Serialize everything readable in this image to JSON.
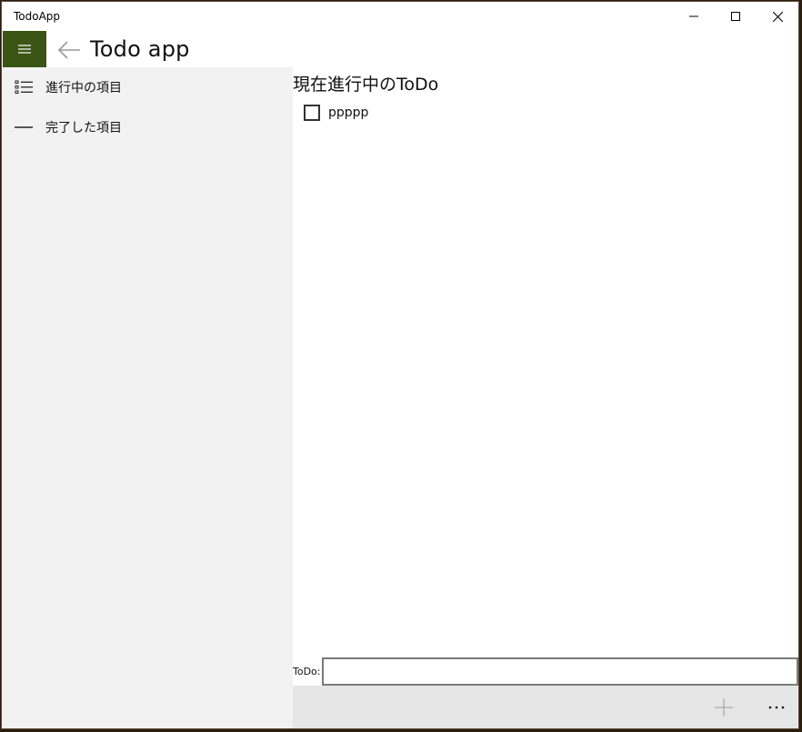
{
  "window": {
    "title": "TodoApp"
  },
  "header": {
    "title": "Todo app"
  },
  "sidebar": {
    "items": [
      {
        "label": "進行中の項目",
        "icon": "bulleted-list-icon"
      },
      {
        "label": "完了した項目",
        "icon": "dash-icon"
      }
    ]
  },
  "main": {
    "section_title": "現在進行中のToDo",
    "todos": [
      {
        "label": "ppppp",
        "checked": false
      }
    ],
    "input_label": "ToDo:",
    "input_value": ""
  },
  "commandbar": {
    "add_icon": "plus-icon",
    "more_icon": "ellipsis-icon",
    "more_label": "…"
  },
  "colors": {
    "accent": "#3a5514",
    "sidebar_bg": "#f2f2f2",
    "commandbar_bg": "#e6e6e6"
  }
}
